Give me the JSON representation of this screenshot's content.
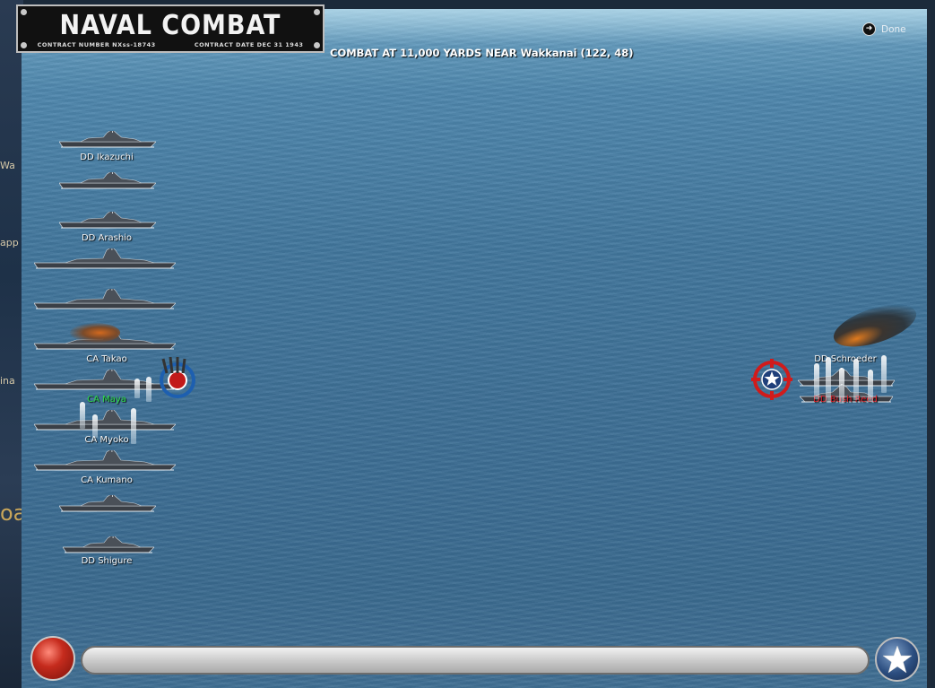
{
  "window": {
    "title": "NAVAL COMBAT",
    "contract_number": "CONTRACT NUMBER  NXss-18743",
    "contract_date": "CONTRACT DATE  DEC  31  1943"
  },
  "combat": {
    "header": "COMBAT AT 11,000 YARDS NEAR Wakkanai (122, 48)"
  },
  "controls": {
    "done_label": "Done",
    "progress_fraction": 0.0
  },
  "map_fragments": [
    "Wa",
    "app",
    "ina",
    "oa"
  ],
  "japanese_ships": [
    {
      "label": "DD Ikazuchi",
      "class": "dd",
      "label_color": "white"
    },
    {
      "label": "",
      "class": "dd",
      "label_color": "white"
    },
    {
      "label": "DD Arashio",
      "class": "dd",
      "label_color": "white"
    },
    {
      "label": "",
      "class": "ca",
      "label_color": "white"
    },
    {
      "label": "",
      "class": "ca",
      "label_color": "white"
    },
    {
      "label": "CA Takao",
      "class": "ca",
      "label_color": "white"
    },
    {
      "label": "CA Maya",
      "class": "ca",
      "label_color": "green"
    },
    {
      "label": "CA Myoko",
      "class": "ca",
      "label_color": "white"
    },
    {
      "label": "CA Kumano",
      "class": "ca",
      "label_color": "white"
    },
    {
      "label": "",
      "class": "dd",
      "label_color": "white"
    },
    {
      "label": "DD Shigure",
      "class": "dd",
      "label_color": "white"
    }
  ],
  "allied_ships": [
    {
      "label": "DD Schroeder",
      "label_color": "white"
    },
    {
      "label": "DD Bush Reed",
      "label_color": "red"
    }
  ],
  "colors": {
    "japanese_target": "#1d5fb0",
    "allied_target": "#d01b1b",
    "sea": "#3d6f95"
  },
  "icons": {
    "record": "record-button-icon",
    "allied": "allied-star-icon",
    "done": "arrow-right-circle-icon"
  }
}
